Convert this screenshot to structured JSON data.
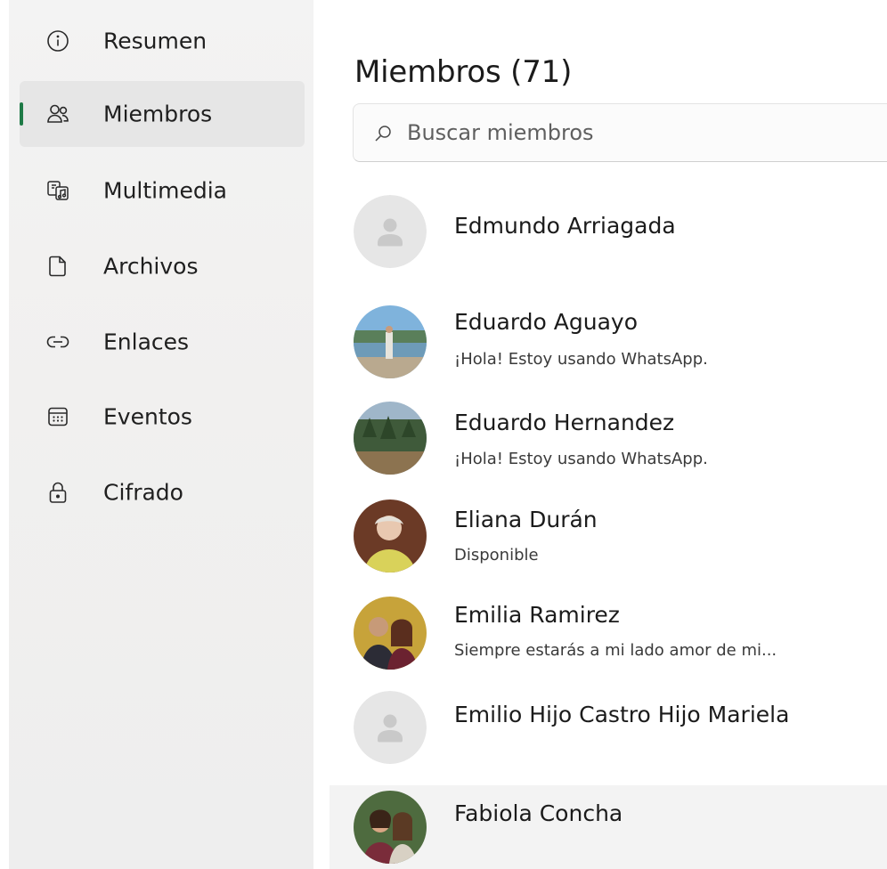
{
  "sidebar": {
    "items": [
      {
        "label": "Resumen",
        "icon": "info-icon",
        "active": false
      },
      {
        "label": "Miembros",
        "icon": "people-icon",
        "active": true
      },
      {
        "label": "Multimedia",
        "icon": "media-icon",
        "active": false
      },
      {
        "label": "Archivos",
        "icon": "file-icon",
        "active": false
      },
      {
        "label": "Enlaces",
        "icon": "link-icon",
        "active": false
      },
      {
        "label": "Eventos",
        "icon": "calendar-icon",
        "active": false
      },
      {
        "label": "Cifrado",
        "icon": "lock-icon",
        "active": false
      }
    ],
    "accent_color": "#1e7a46"
  },
  "main": {
    "title": "Miembros (71)",
    "search": {
      "placeholder": "Buscar miembros",
      "value": ""
    },
    "members": [
      {
        "name": "Edmundo Arriagada",
        "status": "",
        "avatar": "default-avatar"
      },
      {
        "name": "Eduardo Aguayo",
        "status": "¡Hola! Estoy usando WhatsApp.",
        "avatar": "photo-avatar"
      },
      {
        "name": "Eduardo Hernandez",
        "status": "¡Hola! Estoy usando WhatsApp.",
        "avatar": "photo-avatar"
      },
      {
        "name": "Eliana Durán",
        "status": "Disponible",
        "avatar": "photo-avatar"
      },
      {
        "name": "Emilia Ramirez",
        "status": "Siempre estarás a mi lado amor de mi...",
        "avatar": "photo-avatar"
      },
      {
        "name": "Emilio Hijo Castro Hijo Mariela",
        "status": "",
        "avatar": "default-avatar"
      },
      {
        "name": "Fabiola Concha",
        "status": "",
        "avatar": "photo-avatar"
      }
    ]
  }
}
